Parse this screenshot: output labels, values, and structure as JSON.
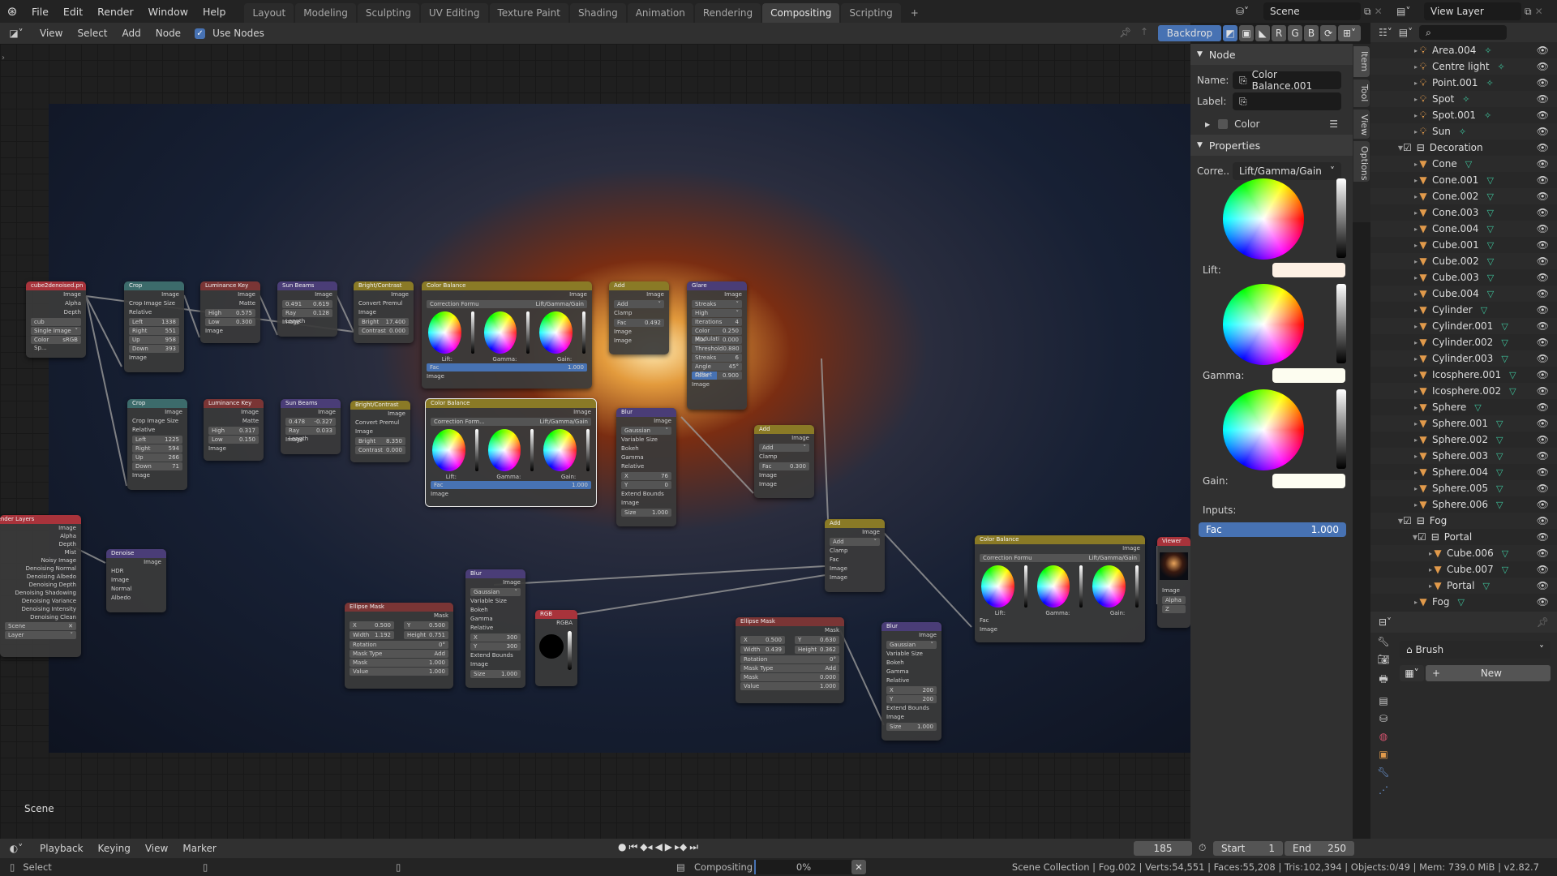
{
  "topbar": {
    "menus": [
      "File",
      "Edit",
      "Render",
      "Window",
      "Help"
    ],
    "workspaces": [
      "Layout",
      "Modeling",
      "Sculpting",
      "UV Editing",
      "Texture Paint",
      "Shading",
      "Animation",
      "Rendering",
      "Compositing",
      "Scripting"
    ],
    "active_workspace": "Compositing",
    "add_tab": "+",
    "scene": "Scene",
    "view_layer": "View Layer"
  },
  "node_header": {
    "menus": [
      "View",
      "Select",
      "Add",
      "Node"
    ],
    "use_nodes_label": "Use Nodes",
    "use_nodes_checked": true,
    "backdrop_label": "Backdrop",
    "channels": [
      "R",
      "G",
      "B"
    ]
  },
  "canvas": {
    "scene_label": "Scene",
    "nodes": {
      "image": {
        "title": "cube2denoised.pn",
        "outputs": [
          "Image",
          "Alpha",
          "Depth"
        ],
        "image_name": "cub",
        "source": "Single Image",
        "colorspace_label": "Color Sp...",
        "colorspace": "sRGB"
      },
      "crop1": {
        "title": "Crop",
        "out": "Image",
        "opts": [
          "Crop Image Size",
          "Relative"
        ],
        "fields": [
          [
            "Left",
            "1338"
          ],
          [
            "Right",
            "551"
          ],
          [
            "Up",
            "958"
          ],
          [
            "Down",
            "393"
          ]
        ],
        "in": "Image"
      },
      "lumkey1": {
        "title": "Luminance Key",
        "outs": [
          "Image",
          "Matte"
        ],
        "fields": [
          [
            "High",
            "0.575"
          ],
          [
            "Low",
            "0.300"
          ]
        ],
        "in": "Image"
      },
      "sunbeams1": {
        "title": "Sun Beams",
        "out": "Image",
        "xy": [
          "0.491",
          "0.619"
        ],
        "ray": [
          "Ray Length",
          "0.128"
        ],
        "in": "Image"
      },
      "bc1": {
        "title": "Bright/Contrast",
        "out": "Image",
        "premul": "Convert Premul",
        "in": "Image",
        "fields": [
          [
            "Bright",
            "17.400"
          ],
          [
            "Contrast",
            "0.000"
          ]
        ]
      },
      "cb1": {
        "title": "Color Balance",
        "out": "Image",
        "formula_label": "Correction Formu",
        "formula": "Lift/Gamma/Gain",
        "labels": [
          "Lift:",
          "Gamma:",
          "Gain:"
        ],
        "fac": [
          "Fac",
          "1.000"
        ],
        "in": "Image"
      },
      "add1": {
        "title": "Add",
        "out": "Image",
        "mode": "Add",
        "clamp": "Clamp",
        "fac": [
          "Fac",
          "0.492"
        ],
        "ins": [
          "Image",
          "Image"
        ]
      },
      "glare": {
        "title": "Glare",
        "out": "Image",
        "type": "Streaks",
        "quality": "High",
        "fields": [
          [
            "Iterations",
            "4"
          ],
          [
            "Color Modulati",
            "0.250"
          ],
          [
            "Mix",
            "0.000"
          ],
          [
            "Threshold",
            "0.880"
          ],
          [
            "Streaks",
            "6"
          ],
          [
            "Angle Offset",
            "45°"
          ],
          [
            "Fade",
            "0.900"
          ]
        ],
        "in": "Image"
      },
      "crop2": {
        "title": "Crop",
        "out": "Image",
        "opts": [
          "Crop Image Size",
          "Relative"
        ],
        "fields": [
          [
            "Left",
            "1225"
          ],
          [
            "Right",
            "594"
          ],
          [
            "Up",
            "266"
          ],
          [
            "Down",
            "71"
          ]
        ],
        "in": "Image"
      },
      "lumkey2": {
        "title": "Luminance Key",
        "outs": [
          "Image",
          "Matte"
        ],
        "fields": [
          [
            "High",
            "0.317"
          ],
          [
            "Low",
            "0.150"
          ]
        ],
        "in": "Image"
      },
      "sunbeams2": {
        "title": "Sun Beams",
        "out": "Image",
        "xy": [
          "0.478",
          "-0.327"
        ],
        "ray": [
          "Ray Length",
          "0.033"
        ],
        "in": "Image"
      },
      "bc2": {
        "title": "Bright/Contrast",
        "out": "Image",
        "premul": "Convert Premul",
        "in": "Image",
        "fields": [
          [
            "Bright",
            "8.350"
          ],
          [
            "Contrast",
            "0.000"
          ]
        ]
      },
      "cb2": {
        "title": "Color Balance",
        "out": "Image",
        "formula_label": "Correction Form...",
        "formula": "Lift/Gamma/Gain",
        "labels": [
          "Lift:",
          "Gamma:",
          "Gain:"
        ],
        "fac": [
          "Fac",
          "1.000"
        ],
        "in": "Image"
      },
      "blur1": {
        "title": "Blur",
        "out": "Image",
        "type": "Gaussian",
        "opts": [
          "Variable Size",
          "Bokeh",
          "Gamma",
          "Relative"
        ],
        "xy": [
          [
            "X",
            "76"
          ],
          [
            "Y",
            "0"
          ]
        ],
        "extend": "Extend Bounds",
        "in": "Image",
        "size": [
          "Size",
          "1.000"
        ]
      },
      "add2": {
        "title": "Add",
        "out": "Image",
        "mode": "Add",
        "clamp": "Clamp",
        "fac": [
          "Fac",
          "0.300"
        ],
        "ins": [
          "Image",
          "Image"
        ]
      },
      "add3": {
        "title": "Add",
        "out": "Image",
        "mode": "Add",
        "clamp": "Clamp",
        "fac_label": "Fac",
        "ins": [
          "Image",
          "Image"
        ]
      },
      "renderlayers": {
        "title": "Render Layers",
        "outputs": [
          "Image",
          "Alpha",
          "Depth",
          "Mist",
          "Noisy Image",
          "Denoising Normal",
          "Denoising Albedo",
          "Denoising Depth",
          "Denoising Shadowing",
          "Denoising Variance",
          "Denoising Intensity",
          "Denoising Clean"
        ],
        "scene": "Scene",
        "layer": "Layer"
      },
      "denoise": {
        "title": "Denoise",
        "out": "Image",
        "hdr": "HDR",
        "ins": [
          "Image",
          "Normal",
          "Albedo"
        ]
      },
      "blur2": {
        "title": "Blur",
        "out": "Image",
        "type": "Gaussian",
        "opts": [
          "Variable Size",
          "Bokeh",
          "Gamma",
          "Relative"
        ],
        "xy": [
          [
            "X",
            "300"
          ],
          [
            "Y",
            "300"
          ]
        ],
        "extend": "Extend Bounds",
        "in": "Image",
        "size": [
          "Size",
          "1.000"
        ]
      },
      "ellipse1": {
        "title": "Ellipse Mask",
        "out": "Mask",
        "xy": [
          [
            "X",
            "0.500"
          ],
          [
            "Y",
            "0.500"
          ]
        ],
        "wh": [
          [
            "Width",
            "1.192"
          ],
          [
            "Height",
            "0.751"
          ]
        ],
        "rotation": [
          "Rotation",
          "0°"
        ],
        "mask_type_label": "Mask Type",
        "mask_type": "Add",
        "fields": [
          [
            "Mask",
            "1.000"
          ],
          [
            "Value",
            "1.000"
          ]
        ]
      },
      "rgb": {
        "title": "RGB",
        "out": "RGBA"
      },
      "ellipse2": {
        "title": "Ellipse Mask",
        "out": "Mask",
        "xy": [
          [
            "X",
            "0.500"
          ],
          [
            "Y",
            "0.630"
          ]
        ],
        "wh": [
          [
            "Width",
            "0.439"
          ],
          [
            "Height",
            "0.362"
          ]
        ],
        "rotation": [
          "Rotation",
          "0°"
        ],
        "mask_type_label": "Mask Type",
        "mask_type": "Add",
        "fields": [
          [
            "Mask",
            "0.000"
          ],
          [
            "Value",
            "1.000"
          ]
        ]
      },
      "blur3": {
        "title": "Blur",
        "out": "Image",
        "type": "Gaussian",
        "opts": [
          "Variable Size",
          "Bokeh",
          "Gamma",
          "Relative"
        ],
        "xy": [
          [
            "X",
            "200"
          ],
          [
            "Y",
            "200"
          ]
        ],
        "extend": "Extend Bounds",
        "in": "Image",
        "size": [
          "Size",
          "1.000"
        ]
      },
      "cb3": {
        "title": "Color Balance",
        "out": "Image",
        "formula_label": "Correction Formu",
        "formula": "Lift/Gamma/Gain",
        "labels": [
          "Lift:",
          "Gamma:",
          "Gain:"
        ],
        "ins": [
          "Fac",
          "Image"
        ]
      },
      "viewer": {
        "title": "Viewer",
        "ins": [
          "Image",
          "Alpha",
          "Z"
        ]
      }
    }
  },
  "sidebar": {
    "tabs": [
      "Item",
      "Tool",
      "View",
      "Options"
    ],
    "node_panel": {
      "title": "Node",
      "name_label": "Name:",
      "name": "Color Balance.001",
      "label_label": "Label:",
      "label": "",
      "color_label": "Color"
    },
    "properties_panel": {
      "title": "Properties",
      "correction_label": "Corre..",
      "correction": "Lift/Gamma/Gain",
      "lift_label": "Lift:",
      "gamma_label": "Gamma:",
      "gain_label": "Gain:",
      "inputs_label": "Inputs:",
      "fac_label": "Fac",
      "fac_value": "1.000",
      "fac_fraction": 1.0,
      "lift_color": "#fdf0e4",
      "gamma_color": "#fdfdf0",
      "gain_color": "#fdfdf2"
    }
  },
  "outliner": {
    "rows": [
      {
        "name": "Area.004",
        "kind": "light",
        "indent": 1
      },
      {
        "name": "Centre light",
        "kind": "light",
        "indent": 1
      },
      {
        "name": "Point.001",
        "kind": "light",
        "indent": 1
      },
      {
        "name": "Spot",
        "kind": "light",
        "indent": 1
      },
      {
        "name": "Spot.001",
        "kind": "light",
        "indent": 1
      },
      {
        "name": "Sun",
        "kind": "light",
        "indent": 1
      },
      {
        "name": "Decoration",
        "kind": "collection",
        "indent": 0
      },
      {
        "name": "Cone",
        "kind": "mesh",
        "indent": 1
      },
      {
        "name": "Cone.001",
        "kind": "mesh",
        "indent": 1
      },
      {
        "name": "Cone.002",
        "kind": "mesh",
        "indent": 1
      },
      {
        "name": "Cone.003",
        "kind": "mesh",
        "indent": 1
      },
      {
        "name": "Cone.004",
        "kind": "mesh",
        "indent": 1
      },
      {
        "name": "Cube.001",
        "kind": "mesh",
        "indent": 1
      },
      {
        "name": "Cube.002",
        "kind": "mesh",
        "indent": 1
      },
      {
        "name": "Cube.003",
        "kind": "mesh",
        "indent": 1
      },
      {
        "name": "Cube.004",
        "kind": "mesh",
        "indent": 1
      },
      {
        "name": "Cylinder",
        "kind": "mesh",
        "indent": 1
      },
      {
        "name": "Cylinder.001",
        "kind": "mesh",
        "indent": 1
      },
      {
        "name": "Cylinder.002",
        "kind": "mesh",
        "indent": 1
      },
      {
        "name": "Cylinder.003",
        "kind": "mesh",
        "indent": 1
      },
      {
        "name": "Icosphere.001",
        "kind": "mesh",
        "indent": 1
      },
      {
        "name": "Icosphere.002",
        "kind": "mesh",
        "indent": 1
      },
      {
        "name": "Sphere",
        "kind": "mesh",
        "indent": 1
      },
      {
        "name": "Sphere.001",
        "kind": "mesh",
        "indent": 1
      },
      {
        "name": "Sphere.002",
        "kind": "mesh",
        "indent": 1
      },
      {
        "name": "Sphere.003",
        "kind": "mesh",
        "indent": 1
      },
      {
        "name": "Sphere.004",
        "kind": "mesh",
        "indent": 1
      },
      {
        "name": "Sphere.005",
        "kind": "mesh",
        "indent": 1
      },
      {
        "name": "Sphere.006",
        "kind": "mesh",
        "indent": 1
      },
      {
        "name": "Fog",
        "kind": "collection",
        "indent": 0
      },
      {
        "name": "Portal",
        "kind": "collection",
        "indent": 1
      },
      {
        "name": "Cube.006",
        "kind": "mesh",
        "indent": 2
      },
      {
        "name": "Cube.007",
        "kind": "mesh",
        "indent": 2
      },
      {
        "name": "Portal",
        "kind": "mesh",
        "indent": 2
      },
      {
        "name": "Fog",
        "kind": "mesh",
        "indent": 1
      }
    ]
  },
  "properties": {
    "brush_label": "Brush",
    "new_label": "New"
  },
  "timeline": {
    "menus": [
      "Playback",
      "Keying",
      "View",
      "Marker"
    ],
    "current_frame": "185",
    "start_label": "Start",
    "start": "1",
    "end_label": "End",
    "end": "250"
  },
  "statusbar": {
    "select_label": "Select",
    "job_label": "Compositing",
    "progress_text": "0%",
    "progress_fraction": 0,
    "stats": "Scene Collection | Fog.002 | Verts:54,551 | Faces:55,208 | Tris:102,394 | Objects:0/49 | Mem: 739.0 MiB | v2.82.7"
  },
  "colors": {
    "accent": "#4772b3",
    "header_yellow": "#8a7a26",
    "object_orange": "#e19a4b",
    "data_green": "#3ec39b"
  }
}
